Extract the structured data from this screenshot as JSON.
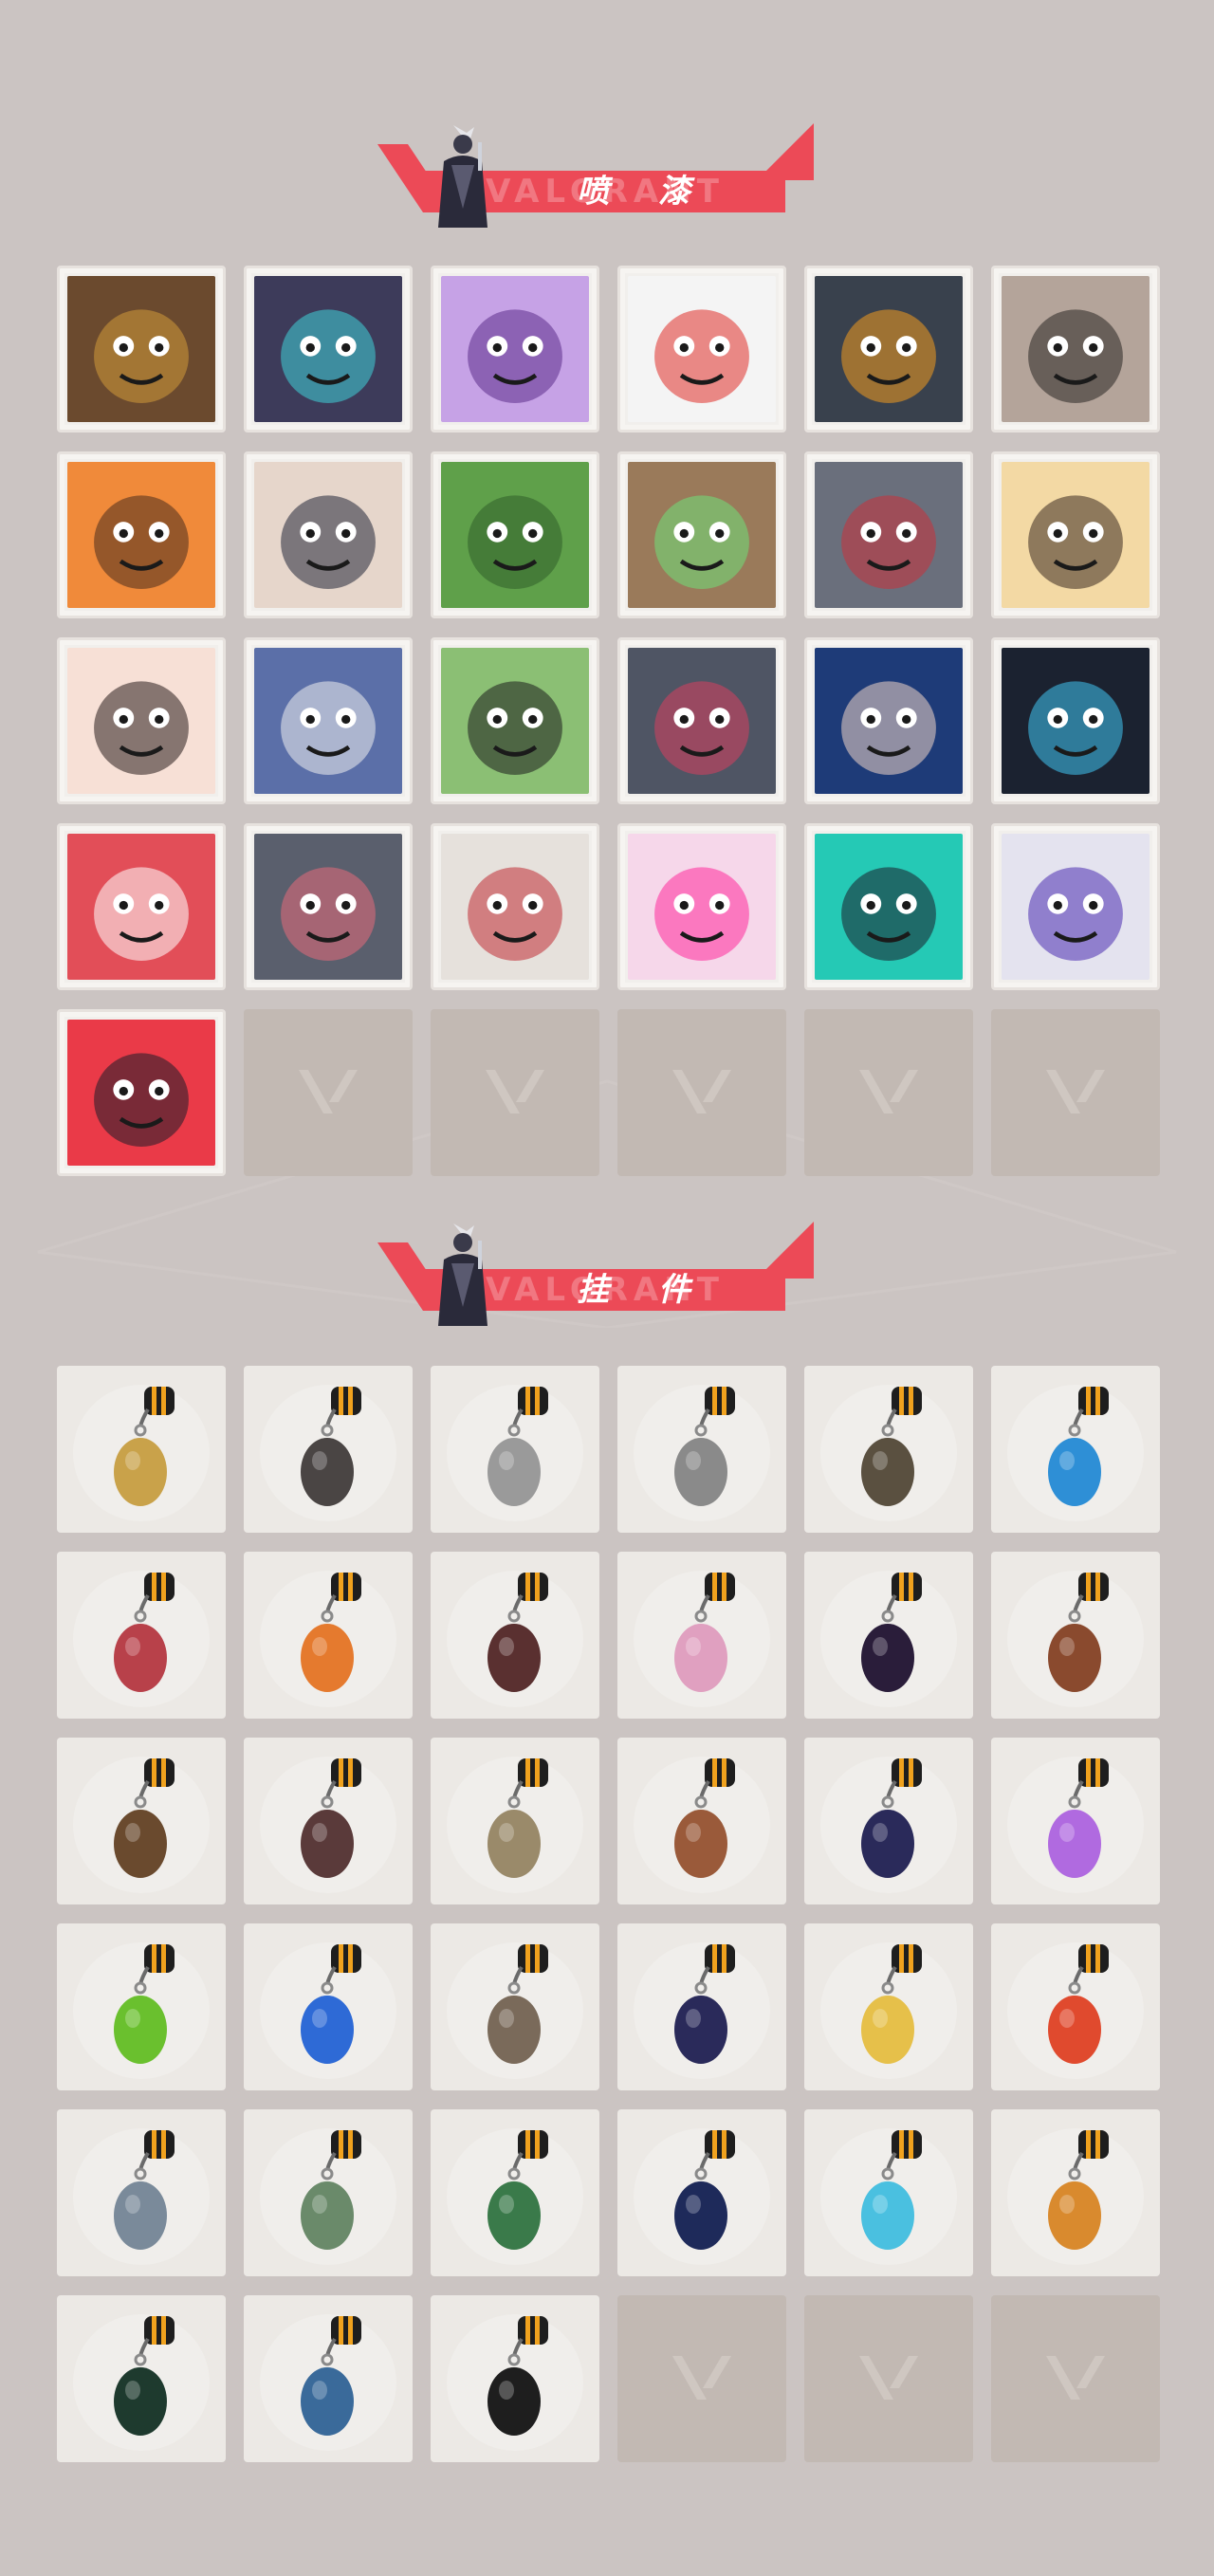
{
  "sections": [
    {
      "id": "sprays",
      "title": "喷 漆",
      "items": [
        {
          "name": "spray-mohawk-agent-icon",
          "color": "#6b4a2e",
          "accent": "#d29a3a"
        },
        {
          "name": "spray-helmet-robot-icon",
          "color": "#3d3b5a",
          "accent": "#3fd1d8"
        },
        {
          "name": "spray-purple-face-icon",
          "color": "#c6a2e6",
          "accent": "#5c2e8a"
        },
        {
          "name": "spray-clown-face-icon",
          "color": "#f4f4f4",
          "accent": "#e0302a"
        },
        {
          "name": "spray-orange-button-icon",
          "color": "#39414d",
          "accent": "#f39a1f"
        },
        {
          "name": "spray-raccoon-icon",
          "color": "#b4a49a",
          "accent": "#2a2624"
        },
        {
          "name": "spray-bearded-man-icon",
          "color": "#f08a3a",
          "accent": "#4b2e1e"
        },
        {
          "name": "spray-dark-hair-boy-icon",
          "color": "#e6d6cb",
          "accent": "#23283a"
        },
        {
          "name": "spray-green-crate-icon",
          "color": "#5fa04a",
          "accent": "#2f5f2a"
        },
        {
          "name": "spray-green-eyes-icon",
          "color": "#9a7a5a",
          "accent": "#6fe07a"
        },
        {
          "name": "spray-crying-blob-icon",
          "color": "#6a6f7c",
          "accent": "#c9323a"
        },
        {
          "name": "spray-tiger-icon",
          "color": "#f3d9a4",
          "accent": "#3a2a20"
        },
        {
          "name": "spray-girl-pencil-icon",
          "color": "#f7e0d6",
          "accent": "#2a1d1d"
        },
        {
          "name": "spray-penguin-beanie-icon",
          "color": "#5b6fa8",
          "accent": "#eeeeee"
        },
        {
          "name": "spray-frog-hat-icon",
          "color": "#8bbf74",
          "accent": "#1e1e1e"
        },
        {
          "name": "spray-grey-cat-icon",
          "color": "#4f5564",
          "accent": "#d7405e"
        },
        {
          "name": "spray-hooded-agent-icon",
          "color": "#1e3b78",
          "accent": "#f0d6c6"
        },
        {
          "name": "spray-blue-flames-icon",
          "color": "#1b2230",
          "accent": "#3fc5f2"
        },
        {
          "name": "spray-ii-zero-icon",
          "color": "#e24e58",
          "accent": "#ffffff"
        },
        {
          "name": "spray-screaming-blob-icon",
          "color": "#5a5f6d",
          "accent": "#e56a7a"
        },
        {
          "name": "spray-red-x-icon",
          "color": "#e6e1dc",
          "accent": "#c02d35"
        },
        {
          "name": "spray-neon-heart-icon",
          "color": "#f6d7ea",
          "accent": "#ff2a9a"
        },
        {
          "name": "spray-valorant-logo-teal-icon",
          "color": "#25c9b5",
          "accent": "#1b1e2a"
        },
        {
          "name": "spray-purple-graffiti-icon",
          "color": "#e4e3ef",
          "accent": "#4a2db0"
        },
        {
          "name": "spray-red-valorant-drip-icon",
          "color": "#ea3a48",
          "accent": "#1b1e2a"
        },
        {
          "name": "empty-slot",
          "empty": true
        },
        {
          "name": "empty-slot",
          "empty": true
        },
        {
          "name": "empty-slot",
          "empty": true
        },
        {
          "name": "empty-slot",
          "empty": true
        },
        {
          "name": "empty-slot",
          "empty": true
        }
      ]
    },
    {
      "id": "buddies",
      "title": "挂 件",
      "items": [
        {
          "name": "buddy-gold-cat-icon",
          "color": "#c9a24a"
        },
        {
          "name": "buddy-drone-icon",
          "color": "#4a4544"
        },
        {
          "name": "buddy-bathtub-icon",
          "color": "#9a9a9a"
        },
        {
          "name": "buddy-armored-cat-icon",
          "color": "#8a8a8a"
        },
        {
          "name": "buddy-bag-icon",
          "color": "#5a5040"
        },
        {
          "name": "buddy-blue-flask-icon",
          "color": "#2e8fd6"
        },
        {
          "name": "buddy-red-sword-icon",
          "color": "#b8414a"
        },
        {
          "name": "buddy-guitar-chili-icon",
          "color": "#e57a2e"
        },
        {
          "name": "buddy-rope-knot-icon",
          "color": "#5a3030"
        },
        {
          "name": "buddy-cupcake-icon",
          "color": "#e0a0c0"
        },
        {
          "name": "buddy-ep9-badge-icon",
          "color": "#2a1d3a"
        },
        {
          "name": "buddy-bear-bell-icon",
          "color": "#8a4a2e"
        },
        {
          "name": "buddy-brown-gun-icon",
          "color": "#6a4a2e"
        },
        {
          "name": "buddy-agent-figure-icon",
          "color": "#5a3a3a"
        },
        {
          "name": "buddy-cowboy-figure-icon",
          "color": "#9a8a6a"
        },
        {
          "name": "buddy-treasure-chest-icon",
          "color": "#9a5a3a"
        },
        {
          "name": "buddy-dark-spirit-icon",
          "color": "#2a2a5a"
        },
        {
          "name": "buddy-lava-lamp-icon",
          "color": "#b06ae0"
        },
        {
          "name": "buddy-green-pager-icon",
          "color": "#6ac02e"
        },
        {
          "name": "buddy-blue-astronaut-icon",
          "color": "#2e6ad6"
        },
        {
          "name": "buddy-radio-icon",
          "color": "#7a6a5a"
        },
        {
          "name": "buddy-ep9-badge-2-icon",
          "color": "#2a2a5a"
        },
        {
          "name": "buddy-banana-icon",
          "color": "#e6c04a"
        },
        {
          "name": "buddy-red-skewer-icon",
          "color": "#e04a2e"
        },
        {
          "name": "buddy-mini-agent-icon",
          "color": "#7a8a9a"
        },
        {
          "name": "buddy-potion-stand-icon",
          "color": "#6a8a6a"
        },
        {
          "name": "buddy-green-can-icon",
          "color": "#3a7a4a"
        },
        {
          "name": "buddy-ep9-badge-3-icon",
          "color": "#1e2a5a"
        },
        {
          "name": "buddy-blue-blade-icon",
          "color": "#4ac0e0"
        },
        {
          "name": "buddy-sun-cloud-icon",
          "color": "#d98a2e"
        },
        {
          "name": "buddy-ep8-badge-icon",
          "color": "#1e3a2e"
        },
        {
          "name": "buddy-ufo-icon",
          "color": "#3a6a9a"
        },
        {
          "name": "buddy-valorant-coin-icon",
          "color": "#1e1e1e"
        },
        {
          "name": "empty-slot",
          "empty": true
        },
        {
          "name": "empty-slot",
          "empty": true
        },
        {
          "name": "empty-slot",
          "empty": true
        }
      ]
    }
  ],
  "banner_ghost_text": "VALORANT",
  "colors": {
    "background": "#cbc4c2",
    "banner_red": "#ec4a57",
    "empty_cell": "#c2b9b3",
    "cell_light": "#ece9e5"
  }
}
